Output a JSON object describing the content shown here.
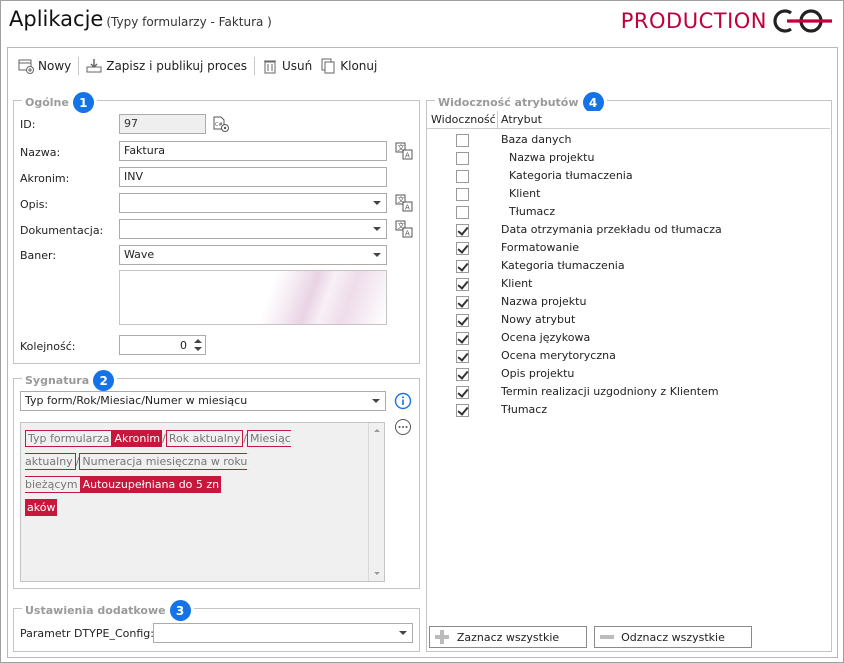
{
  "header": {
    "title": "Aplikacje",
    "subtitle": "(Typy formularzy - Faktura )",
    "brand": "PRODUCTION"
  },
  "toolbar": {
    "new_label": "Nowy",
    "save_label": "Zapisz i publikuj proces",
    "delete_label": "Usuń",
    "clone_label": "Klonuj"
  },
  "general": {
    "legend": "Ogólne",
    "badge": "1",
    "id_label": "ID:",
    "id_value": "97",
    "name_label": "Nazwa:",
    "name_value": "Faktura",
    "acronym_label": "Akronim:",
    "acronym_value": "INV",
    "desc_label": "Opis:",
    "desc_value": "",
    "doc_label": "Dokumentacja:",
    "doc_value": "",
    "banner_label": "Baner:",
    "banner_value": "Wave",
    "order_label": "Kolejność:",
    "order_value": "0"
  },
  "signature": {
    "legend": "Sygnatura",
    "badge": "2",
    "format_value": "Typ form/Rok/Miesiac/Numer w miesiącu",
    "tokens": {
      "t1": "Typ formularza",
      "t2": "Akronim",
      "t3": "Rok aktualny",
      "t4": "Miesiąc aktualny",
      "t5": "Numeracja miesięczna w roku bieżącym",
      "t6a": "Autouzupełniana do 5 zn",
      "t6b": "aków",
      "sep": "/"
    }
  },
  "additional": {
    "legend": "Ustawienia dodatkowe",
    "badge": "3",
    "param_label": "Parametr DTYPE_Config:",
    "param_value": ""
  },
  "visibility": {
    "legend": "Widoczność atrybutów",
    "badge": "4",
    "col_visibility": "Widoczność",
    "col_attribute": "Atrybut",
    "rows": [
      {
        "label": "Baza danych",
        "checked": false,
        "indent": 0
      },
      {
        "label": "Nazwa projektu",
        "checked": false,
        "indent": 1
      },
      {
        "label": "Kategoria tłumaczenia",
        "checked": false,
        "indent": 1
      },
      {
        "label": "Klient",
        "checked": false,
        "indent": 1
      },
      {
        "label": "Tłumacz",
        "checked": false,
        "indent": 1
      },
      {
        "label": "Data otrzymania przekładu od tłumacza",
        "checked": true,
        "indent": 0
      },
      {
        "label": "Formatowanie",
        "checked": true,
        "indent": 0
      },
      {
        "label": "Kategoria tłumaczenia",
        "checked": true,
        "indent": 0
      },
      {
        "label": "Klient",
        "checked": true,
        "indent": 0
      },
      {
        "label": "Nazwa projektu",
        "checked": true,
        "indent": 0
      },
      {
        "label": "Nowy atrybut",
        "checked": true,
        "indent": 0
      },
      {
        "label": "Ocena językowa",
        "checked": true,
        "indent": 0
      },
      {
        "label": "Ocena merytoryczna",
        "checked": true,
        "indent": 0
      },
      {
        "label": "Opis projektu",
        "checked": true,
        "indent": 0
      },
      {
        "label": "Termin realizacji uzgodniony z Klientem",
        "checked": true,
        "indent": 0
      },
      {
        "label": "Tłumacz",
        "checked": true,
        "indent": 0
      }
    ],
    "select_all_label": "Zaznacz wszystkie",
    "deselect_all_label": "Odznacz wszystkie"
  },
  "colors": {
    "accent_red": "#c7173d",
    "badge_blue": "#1473e6",
    "brand_red": "#c0003c"
  }
}
